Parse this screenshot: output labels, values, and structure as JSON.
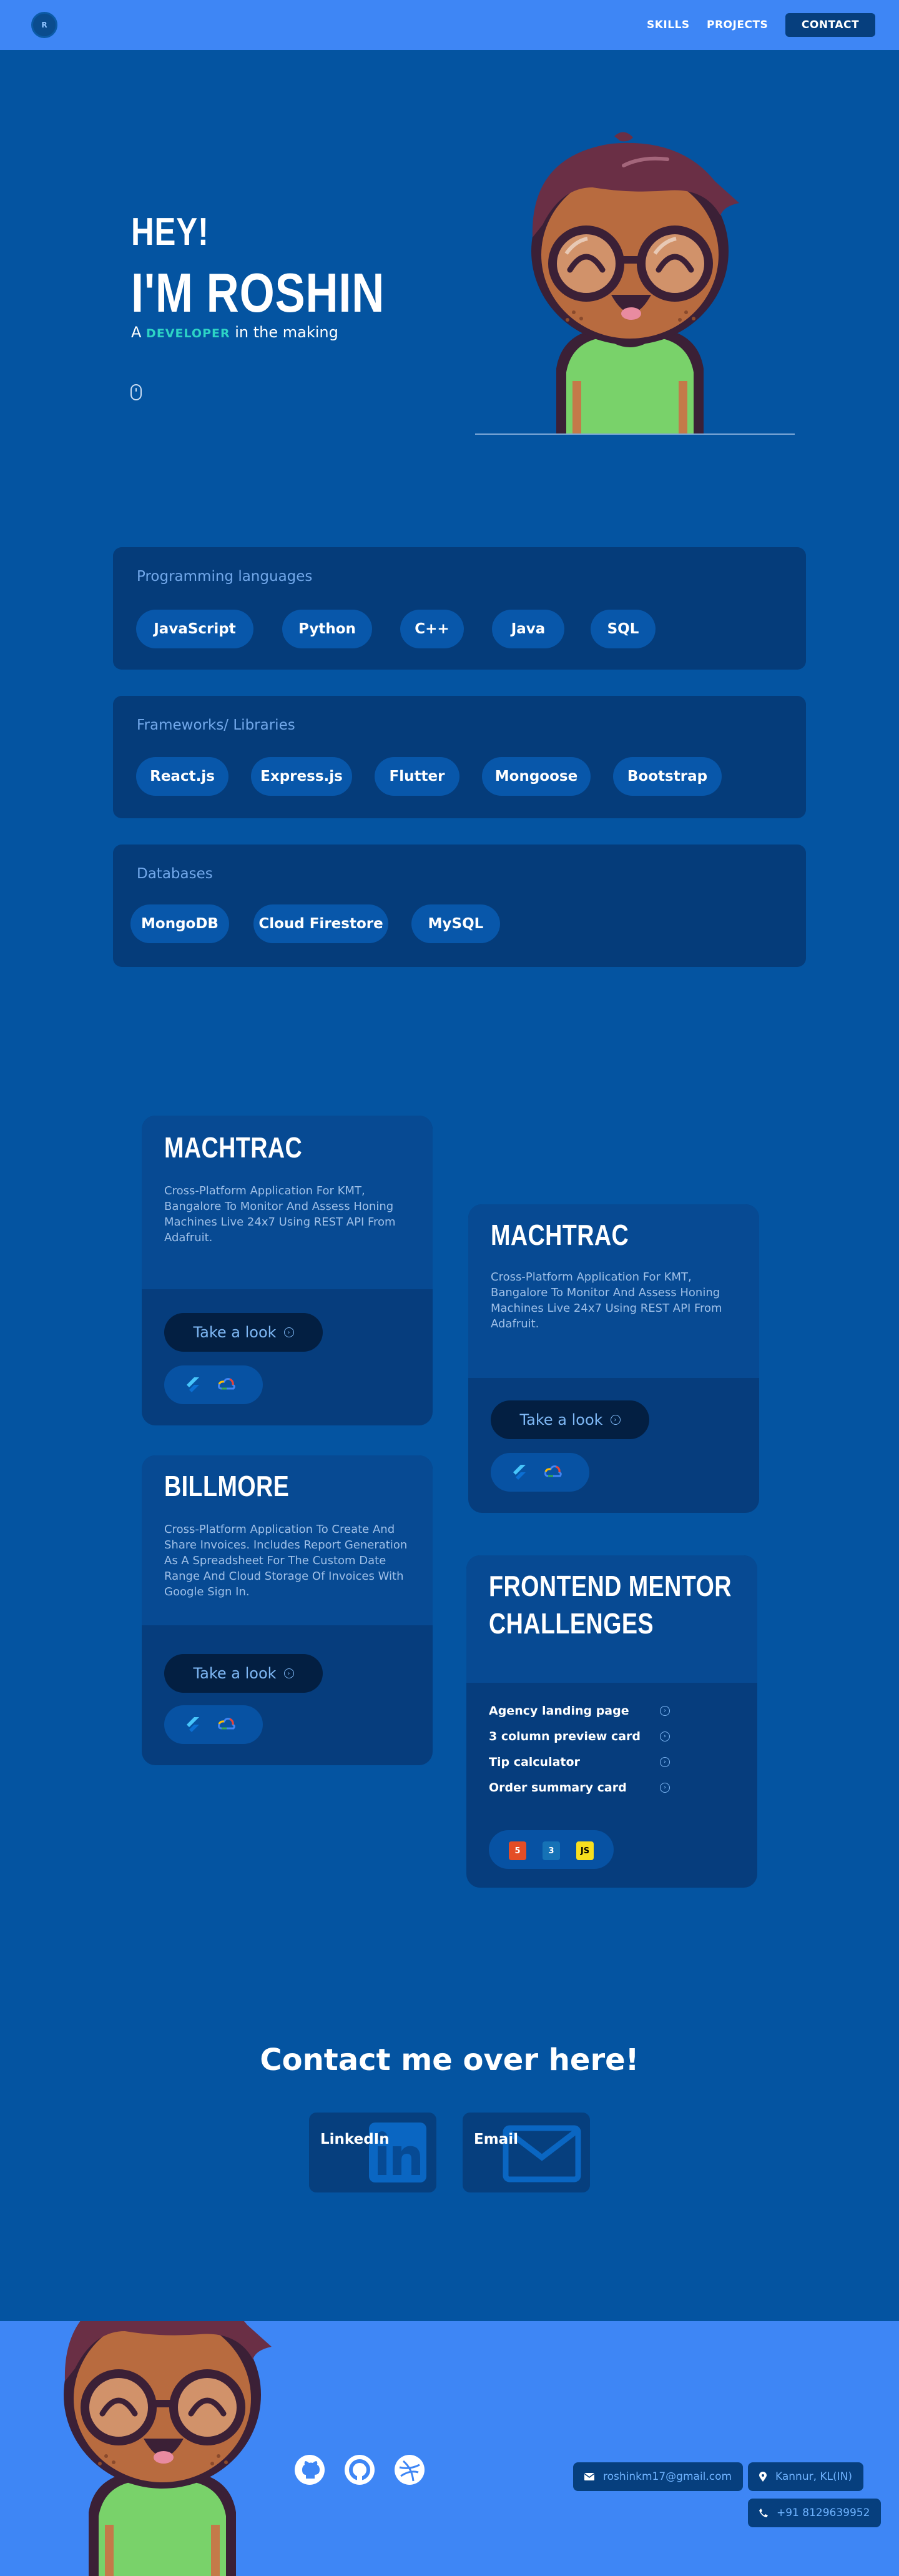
{
  "nav": {
    "logo": "R",
    "links": [
      "SKILLS",
      "PROJECTS"
    ],
    "contact": "CONTACT"
  },
  "hero": {
    "greeting": "HEY!",
    "name": "I'M ROSHIN",
    "sub_prefix": "A ",
    "sub_highlight": "DEVELOPER",
    "sub_suffix": " in the making",
    "colors": {
      "highlight": "#2dd4c5"
    }
  },
  "skills": [
    {
      "title": "Programming languages",
      "items": [
        "JavaScript",
        "Python",
        "C++",
        "Java",
        "SQL"
      ]
    },
    {
      "title": "Frameworks/ Libraries",
      "items": [
        "React.js",
        "Express.js",
        "Flutter",
        "Mongoose",
        "Bootstrap"
      ]
    },
    {
      "title": "Databases",
      "items": [
        "MongoDB",
        "Cloud Firestore",
        "MySQL"
      ]
    }
  ],
  "projects": {
    "p1": {
      "title": "MACHTRAC",
      "desc": "Cross-Platform Application For KMT, Bangalore To Monitor And Assess Honing Machines Live 24x7 Using REST API From Adafruit.",
      "button": "Take a look",
      "tech": [
        "flutter-icon",
        "google-cloud-icon"
      ]
    },
    "p2": {
      "title": "MACHTRAC",
      "desc": "Cross-Platform Application For KMT, Bangalore To Monitor And Assess Honing Machines Live 24x7 Using REST API From Adafruit.",
      "button": "Take a look",
      "tech": [
        "flutter-icon",
        "google-cloud-icon"
      ]
    },
    "p3": {
      "title": "BILLMORE",
      "desc": "Cross-Platform Application To Create And Share Invoices. Includes Report Generation As A Spreadsheet For The Custom Date Range And Cloud Storage Of Invoices With Google Sign In.",
      "button": "Take a look",
      "tech": [
        "flutter-icon",
        "google-cloud-icon"
      ]
    },
    "p4": {
      "title_line1": "FRONTEND MENTOR",
      "title_line2": "CHALLENGES",
      "items": [
        "Agency landing page",
        "3 column preview card",
        "Tip calculator",
        "Order summary card"
      ],
      "badges": [
        "5",
        "3",
        "JS"
      ],
      "tech": [
        "html5-icon",
        "css3-icon",
        "javascript-icon"
      ]
    }
  },
  "contact": {
    "title": "Contact me over here!",
    "linkedin": "LinkedIn",
    "email": "Email"
  },
  "footer": {
    "email": "roshinkm17@gmail.com",
    "location": "Kannur, KL(IN)",
    "phone": "+91 8129639952",
    "social": [
      "github-icon",
      "open-source-icon",
      "dribbble-icon"
    ]
  }
}
